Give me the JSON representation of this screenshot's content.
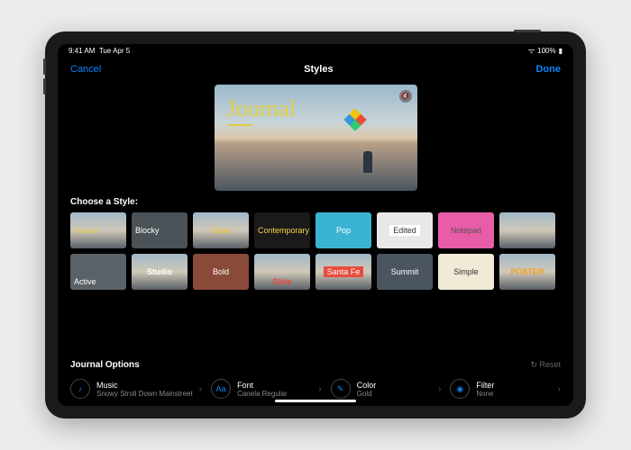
{
  "status": {
    "time": "9:41 AM",
    "date": "Tue Apr 5",
    "battery": "100%"
  },
  "nav": {
    "cancel": "Cancel",
    "title": "Styles",
    "done": "Done"
  },
  "preview": {
    "title": "Journal"
  },
  "choose_label": "Choose a Style:",
  "styles_row1": [
    {
      "label": "Journal",
      "color": "#e0d040",
      "bg": "beach",
      "align": "left",
      "font": "serif"
    },
    {
      "label": "Blocky",
      "color": "#ffffff",
      "bg": "#4a5258",
      "align": "left"
    },
    {
      "label": "Cheer",
      "color": "#f5c518",
      "bg": "beach",
      "font": "cursive"
    },
    {
      "label": "Contemporary",
      "color": "#f5d547",
      "bg": "#1a1a1a",
      "align": "left"
    },
    {
      "label": "Pop",
      "color": "#ffffff",
      "bg": "#3bb4d4"
    },
    {
      "label": "Edited",
      "color": "#333",
      "bg": "#e8e8e8",
      "box": "#fff"
    },
    {
      "label": "Notepad",
      "color": "#555",
      "bg": "#e85da8"
    },
    {
      "label": "Title",
      "color": "#ccc",
      "bg": "beach",
      "align": "left"
    }
  ],
  "styles_row2": [
    {
      "label": "Active",
      "color": "#ffffff",
      "bg": "#5a6268",
      "align": "left",
      "bottom": true
    },
    {
      "label": "Studio",
      "color": "#ffffff",
      "bg": "beach",
      "bold": true
    },
    {
      "label": "Bold",
      "color": "#fff",
      "bg": "#8a4a3a"
    },
    {
      "label": "Slide",
      "color": "#e74c3c",
      "bg": "beach",
      "bold": true,
      "bottom": true
    },
    {
      "label": "Santa Fe",
      "color": "#fff",
      "bg": "beach",
      "box": "#e74c3c"
    },
    {
      "label": "Summit",
      "color": "#fff",
      "bg": "#4a5560"
    },
    {
      "label": "Simple",
      "color": "#333",
      "bg": "#f0ead6"
    },
    {
      "label": "POSTER",
      "color": "#f0a020",
      "bg": "beach",
      "bold": true
    }
  ],
  "options": {
    "title": "Journal Options",
    "reset": "Reset",
    "items": [
      {
        "icon": "♪",
        "label": "Music",
        "value": "Snowy Stroll Down Mainstreet"
      },
      {
        "icon": "Aa",
        "label": "Font",
        "value": "Canela Regular"
      },
      {
        "icon": "✎",
        "label": "Color",
        "value": "Gold"
      },
      {
        "icon": "◉",
        "label": "Filter",
        "value": "None"
      }
    ]
  }
}
